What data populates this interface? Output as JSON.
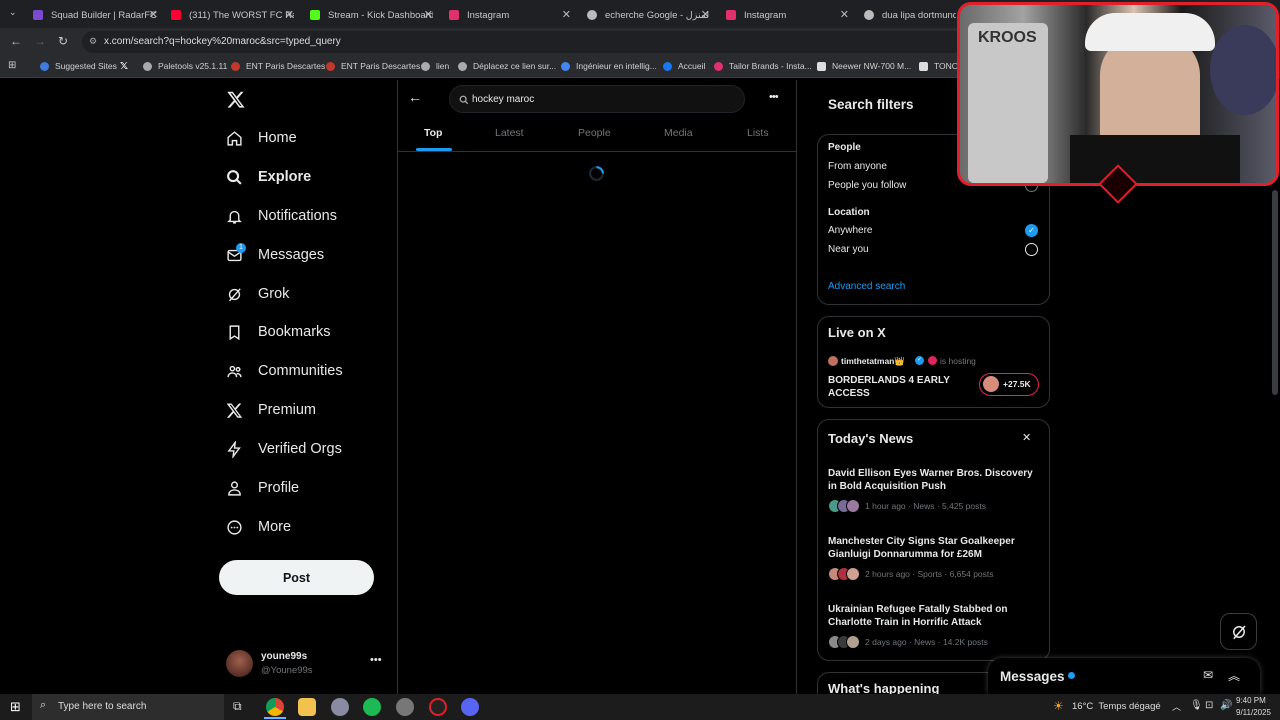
{
  "browser": {
    "tabs": [
      {
        "title": "Squad Builder | RadarFC",
        "color": "#7a4bd1"
      },
      {
        "title": "(311) The WORST FC Rag...",
        "color": "#ff0033"
      },
      {
        "title": "Stream - Kick Dashboard",
        "color": "#53fc18"
      },
      {
        "title": "Instagram",
        "color": "#e1306c"
      },
      {
        "title": "echerche Google - المنزل",
        "color": "#bbbbbb"
      },
      {
        "title": "Instagram",
        "color": "#e1306c"
      },
      {
        "title": "dua lipa dortmund - R",
        "color": "#bbbbbb"
      }
    ],
    "url": "x.com/search?q=hockey%20maroc&src=typed_query",
    "bookmarks": [
      {
        "label": "Suggested Sites",
        "color": "#3d7be0"
      },
      {
        "label": "",
        "color": "#ffffff"
      },
      {
        "label": "Paletools v25.1.11",
        "color": "#aaaaaa"
      },
      {
        "label": "ENT Paris Descartes",
        "color": "#c0392b"
      },
      {
        "label": "ENT Paris Descartes",
        "color": "#c0392b"
      },
      {
        "label": "lien",
        "color": "#aaaaaa"
      },
      {
        "label": "Déplacez ce lien sur...",
        "color": "#aaaaaa"
      },
      {
        "label": "Ingénieur en intellig...",
        "color": "#4285f4"
      },
      {
        "label": "Accueil",
        "color": "#1877f2"
      },
      {
        "label": "Tailor Brands - Insta...",
        "color": "#e1306c"
      },
      {
        "label": "Neewer NW-700 M...",
        "color": "#dddddd"
      },
      {
        "label": "TONOR",
        "color": "#dddddd"
      }
    ]
  },
  "sidebar": {
    "items": [
      {
        "label": "Home",
        "icon": "home-icon"
      },
      {
        "label": "Explore",
        "icon": "search-icon"
      },
      {
        "label": "Notifications",
        "icon": "bell-icon"
      },
      {
        "label": "Messages",
        "icon": "envelope-icon"
      },
      {
        "label": "Grok",
        "icon": "grok-icon"
      },
      {
        "label": "Bookmarks",
        "icon": "bookmark-icon"
      },
      {
        "label": "Communities",
        "icon": "people-icon"
      },
      {
        "label": "Premium",
        "icon": "x-logo-icon"
      },
      {
        "label": "Verified Orgs",
        "icon": "lightning-icon"
      },
      {
        "label": "Profile",
        "icon": "person-icon"
      },
      {
        "label": "More",
        "icon": "more-circle-icon"
      }
    ],
    "messages_badge": "1",
    "post_label": "Post",
    "account": {
      "name": "youne99s",
      "handle": "@Youne99s"
    }
  },
  "search": {
    "query": "hockey maroc",
    "tabs": [
      "Top",
      "Latest",
      "People",
      "Media",
      "Lists"
    ]
  },
  "filters": {
    "title": "Search filters",
    "people_heading": "People",
    "people_options": [
      "From anyone",
      "People you follow"
    ],
    "location_heading": "Location",
    "location_options": [
      "Anywhere",
      "Near you"
    ],
    "advanced": "Advanced search"
  },
  "live": {
    "title": "Live on X",
    "host": "timthetatman👑",
    "hosting": "is hosting",
    "stream_title": "BORDERLANDS 4 EARLY ACCESS",
    "count": "+27.5K"
  },
  "news": {
    "title": "Today's News",
    "items": [
      {
        "headline": "David Ellison Eyes Warner Bros. Discovery in Bold Acquisition Push",
        "meta": "1 hour ago · News · 5,425 posts"
      },
      {
        "headline": "Manchester City Signs Star Goalkeeper Gianluigi Donnarumma for £26M",
        "meta": "2 hours ago · Sports · 6,654 posts"
      },
      {
        "headline": "Ukrainian Refugee Fatally Stabbed on Charlotte Train in Horrific Attack",
        "meta": "2 days ago · News · 14.2K posts"
      }
    ]
  },
  "whats_happening": "What's happening",
  "messages_drawer": "Messages",
  "webcam": {
    "jersey_text": "KROOS"
  },
  "taskbar": {
    "search_placeholder": "Type here to search",
    "weather": "16°C  Temps dégagé",
    "time": "9:40 PM",
    "date": "9/11/2025"
  },
  "colors": {
    "accent": "#1d9bf0",
    "background": "#000000",
    "border": "#2f3336",
    "webcam_frame": "#e0202a"
  }
}
